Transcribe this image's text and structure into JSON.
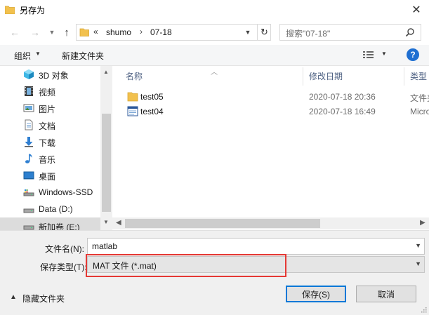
{
  "window": {
    "title": "另存为"
  },
  "address": {
    "chevron": "«",
    "segments": [
      "shumo",
      "07-18"
    ],
    "separator": "›"
  },
  "search": {
    "placeholder": "搜索\"07-18\""
  },
  "toolbar": {
    "organize": "组织",
    "new_folder": "新建文件夹"
  },
  "nav": {
    "items": [
      {
        "label": "3D 对象",
        "icon": "3d-objects-icon"
      },
      {
        "label": "视频",
        "icon": "video-icon"
      },
      {
        "label": "图片",
        "icon": "pictures-icon"
      },
      {
        "label": "文档",
        "icon": "documents-icon"
      },
      {
        "label": "下载",
        "icon": "downloads-icon"
      },
      {
        "label": "音乐",
        "icon": "music-icon"
      },
      {
        "label": "桌面",
        "icon": "desktop-icon"
      },
      {
        "label": "Windows-SSD",
        "icon": "drive-icon"
      },
      {
        "label": "Data (D:)",
        "icon": "drive-icon"
      },
      {
        "label": "新加卷 (E:)",
        "icon": "drive-icon"
      }
    ]
  },
  "columns": {
    "name": "名称",
    "modified": "修改日期",
    "type": "类型"
  },
  "files": [
    {
      "name": "test05",
      "modified": "2020-07-18 20:36",
      "type": "文件夹",
      "icon": "folder-icon"
    },
    {
      "name": "test04",
      "modified": "2020-07-18 16:49",
      "type": "Micro",
      "icon": "document-icon"
    }
  ],
  "form": {
    "filename_label": "文件名(N):",
    "filename_value": "matlab",
    "filetype_label": "保存类型(T):",
    "filetype_value": "MAT 文件 (*.mat)"
  },
  "footer": {
    "hide_folders": "隐藏文件夹",
    "save": "保存(S)",
    "cancel": "取消"
  },
  "colors": {
    "accent": "#0078d7",
    "highlight": "#e53935",
    "folder": "#f2c14e"
  }
}
